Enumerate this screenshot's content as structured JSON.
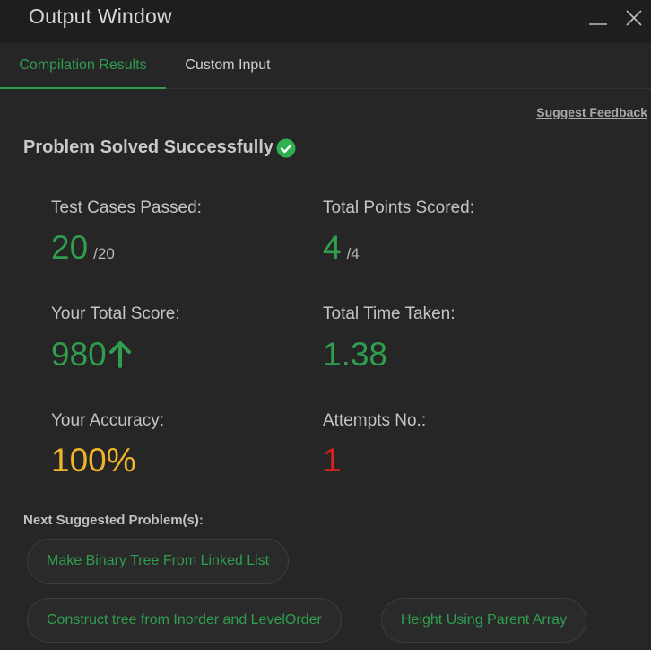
{
  "window": {
    "title": "Output Window"
  },
  "tabs": [
    {
      "label": "Compilation Results",
      "active": true
    },
    {
      "label": "Custom Input",
      "active": false
    }
  ],
  "feedback_link": "Suggest Feedback",
  "status": {
    "message": "Problem Solved Successfully",
    "icon": "check-circle-icon"
  },
  "stats": {
    "test_cases": {
      "label": "Test Cases Passed:",
      "value": "20",
      "total": "/20"
    },
    "points": {
      "label": "Total Points Scored:",
      "value": "4",
      "total": "/4"
    },
    "score": {
      "label": "Your Total Score:",
      "value": "980",
      "icon": "arrow-up-icon"
    },
    "time": {
      "label": "Total Time Taken:",
      "value": "1.38"
    },
    "accuracy": {
      "label": "Your Accuracy:",
      "value": "100%"
    },
    "attempts": {
      "label": "Attempts No.:",
      "value": "1"
    }
  },
  "suggested": {
    "label": "Next Suggested Problem(s):",
    "items": [
      "Make Binary Tree From Linked List",
      "Construct tree from Inorder and LevelOrder",
      "Height Using Parent Array"
    ]
  },
  "colors": {
    "accent": "#2f9e4f",
    "accuracy": "#f0b429",
    "attempts": "#e01e1e",
    "background": "#262626"
  }
}
